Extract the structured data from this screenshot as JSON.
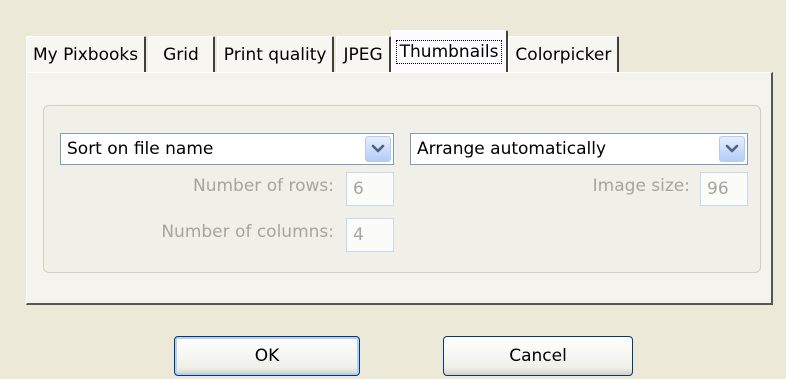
{
  "tabs": [
    {
      "label": "My Pixbooks",
      "active": false
    },
    {
      "label": "Grid",
      "active": false
    },
    {
      "label": "Print quality",
      "active": false
    },
    {
      "label": "JPEG",
      "active": false
    },
    {
      "label": "Thumbnails",
      "active": true
    },
    {
      "label": "Colorpicker",
      "active": false
    }
  ],
  "thumbnails": {
    "sort_value": "Sort on file name",
    "arrange_value": "Arrange automatically",
    "rows_label": "Number of rows:",
    "rows_value": "6",
    "columns_label": "Number of columns:",
    "columns_value": "4",
    "image_size_label": "Image size:",
    "image_size_value": "96"
  },
  "buttons": {
    "ok_label": "OK",
    "cancel_label": "Cancel"
  },
  "colors": {
    "dialog_bg": "#ece9d8",
    "disabled_text": "#a7a69a",
    "combo_border": "#7f9db9",
    "button_border": "#003c74"
  }
}
